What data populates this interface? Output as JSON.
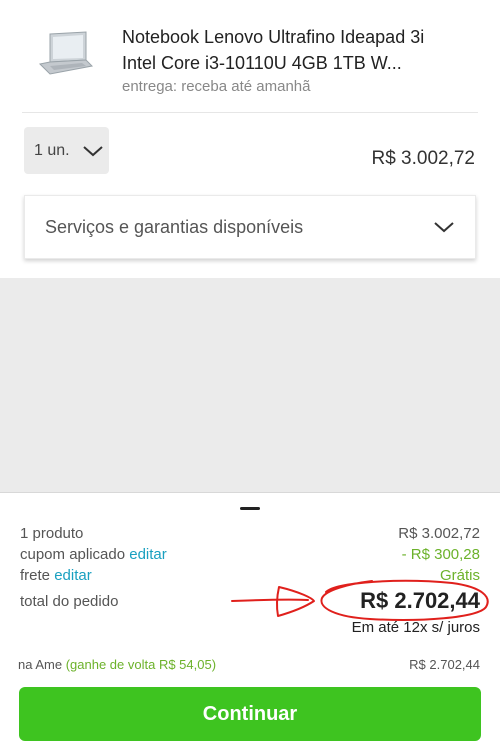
{
  "product": {
    "title": "Notebook Lenovo Ultrafino Ideapad 3i Intel Core i3-10110U 4GB 1TB W...",
    "delivery": "entrega: receba até amanhã",
    "quantity": "1 un.",
    "price": "R$ 3.002,72",
    "services_label": "Serviços e garantias disponíveis"
  },
  "summary": {
    "products_label": "1 produto",
    "products_value": "R$ 3.002,72",
    "coupon_label": "cupom aplicado",
    "coupon_edit": "editar",
    "coupon_value": "- R$ 300,28",
    "shipping_label": "frete",
    "shipping_edit": "editar",
    "shipping_value": "Grátis",
    "total_label": "total do pedido",
    "total_value": "R$ 2.702,44",
    "installments": "Em até 12x s/ juros",
    "ame_label": "na Ame",
    "ame_cashback": "(ganhe de volta R$ 54,05)",
    "ame_value": "R$ 2.702,44",
    "continue_label": "Continuar"
  },
  "colors": {
    "accent_green": "#3ec420",
    "link_blue": "#1aa0c0",
    "annotation_red": "#e0201c"
  },
  "icons": [
    "laptop-thumbnail",
    "chevron-down-icon"
  ]
}
